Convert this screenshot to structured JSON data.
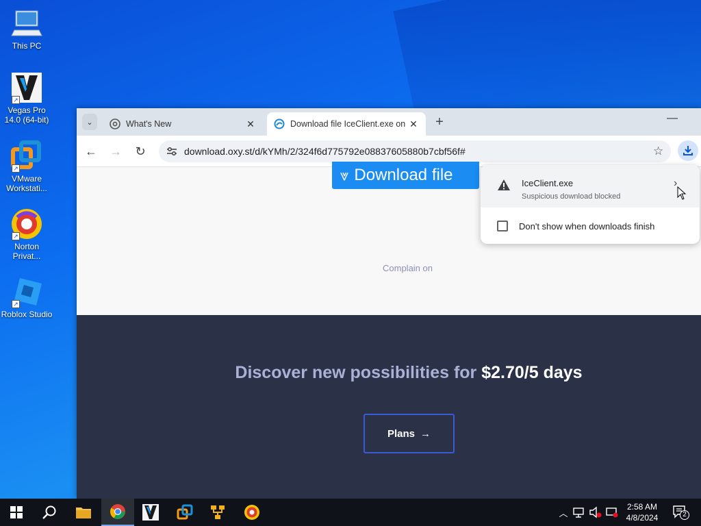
{
  "desktop": {
    "icons": [
      {
        "label": "This PC",
        "icon": "computer-icon"
      },
      {
        "label": "Vegas Pro 14.0 (64-bit)",
        "icon": "vegas-pro-icon"
      },
      {
        "label": "VMware Workstati...",
        "icon": "vmware-icon"
      },
      {
        "label": "Norton Privat...",
        "icon": "norton-browser-icon"
      },
      {
        "label": "Roblox Studio",
        "icon": "roblox-studio-icon"
      }
    ]
  },
  "browser": {
    "tabs": [
      {
        "title": "What's New",
        "icon": "chrome-icon",
        "active": false
      },
      {
        "title": "Download file IceClient.exe on",
        "icon": "oxy-icon",
        "active": true
      }
    ],
    "address": "download.oxy.st/d/kYMh/2/324f6d775792e08837605880b7cbf56f#"
  },
  "page": {
    "download_button": "Download file",
    "complain_link": "Complain on",
    "promo_text": "Discover new possibilities for",
    "promo_price": "$2.70/5 days",
    "plans_button": "Plans"
  },
  "download_bubble": {
    "filename": "IceClient.exe",
    "status": "Suspicious download blocked",
    "option": "Don't show when downloads finish"
  },
  "taskbar": {
    "time": "2:58 AM",
    "date": "4/8/2024",
    "notification_count": "2"
  },
  "colors": {
    "accent_blue": "#1a8cf2",
    "promo_bg": "#2b3147",
    "plans_border": "#3a5ad8"
  }
}
